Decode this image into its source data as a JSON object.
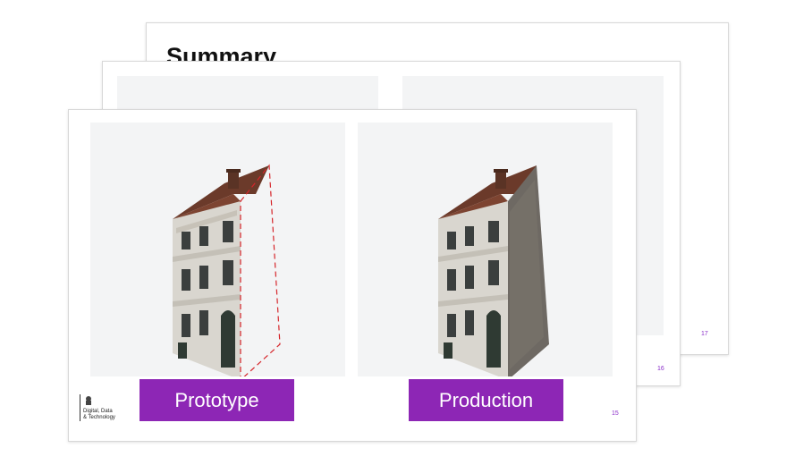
{
  "slides": {
    "back": {
      "title": "Summary",
      "page_number": "17"
    },
    "middle": {
      "page_number": "16"
    },
    "front": {
      "page_number": "15",
      "left_label": "Prototype",
      "right_label": "Production",
      "logo": {
        "line1": "Digital, Data",
        "line2": "& Technology"
      }
    }
  },
  "colors": {
    "accent_purple": "#8d26b5",
    "page_number": "#8b2fc9",
    "panel_bg": "#f3f4f5",
    "prototype_outline": "#d6262b"
  },
  "icons": [
    "crest-icon",
    "house-render"
  ]
}
